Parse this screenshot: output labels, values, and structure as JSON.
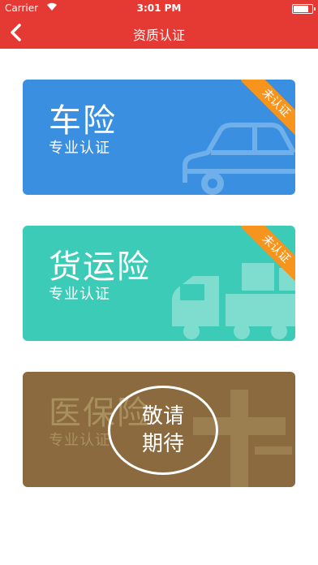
{
  "status_bar": {
    "carrier": "Carrier",
    "time": "3:01 PM",
    "battery_level": 0.85
  },
  "nav": {
    "title": "资质认证"
  },
  "cards": [
    {
      "title": "车险",
      "subtitle": "专业认证",
      "badge": "未认证",
      "color": "#3b8fe0",
      "icon": "car-icon"
    },
    {
      "title": "货运险",
      "subtitle": "专业认证",
      "badge": "未认证",
      "color": "#3bcbb6",
      "icon": "truck-icon"
    },
    {
      "title": "医保险",
      "subtitle": "专业认证",
      "color": "#8a6a3e",
      "icon": "medical-cross-icon"
    }
  ],
  "coming_soon": {
    "line1": "敬请",
    "line2": "期待"
  },
  "colors": {
    "header": "#e53a34",
    "badge": "#f7941d"
  }
}
